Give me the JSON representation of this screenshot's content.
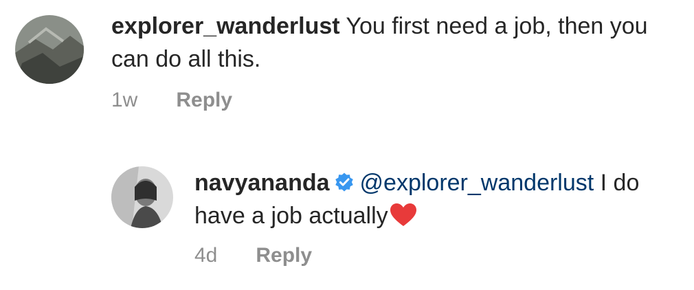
{
  "comments": [
    {
      "username": "explorer_wanderlust",
      "text": " You first need a job, then you can do all this.",
      "time": "1w",
      "reply_label": "Reply"
    },
    {
      "username": "navyananda",
      "verified": true,
      "mention": "@explorer_wanderlust",
      "text": " I do have a job actually",
      "emoji": "red-heart",
      "time": "4d",
      "reply_label": "Reply"
    }
  ],
  "colors": {
    "text": "#262626",
    "muted": "#8e8e8e",
    "mention": "#00376b",
    "verified_badge": "#3897f0",
    "heart": "#ed4956"
  }
}
